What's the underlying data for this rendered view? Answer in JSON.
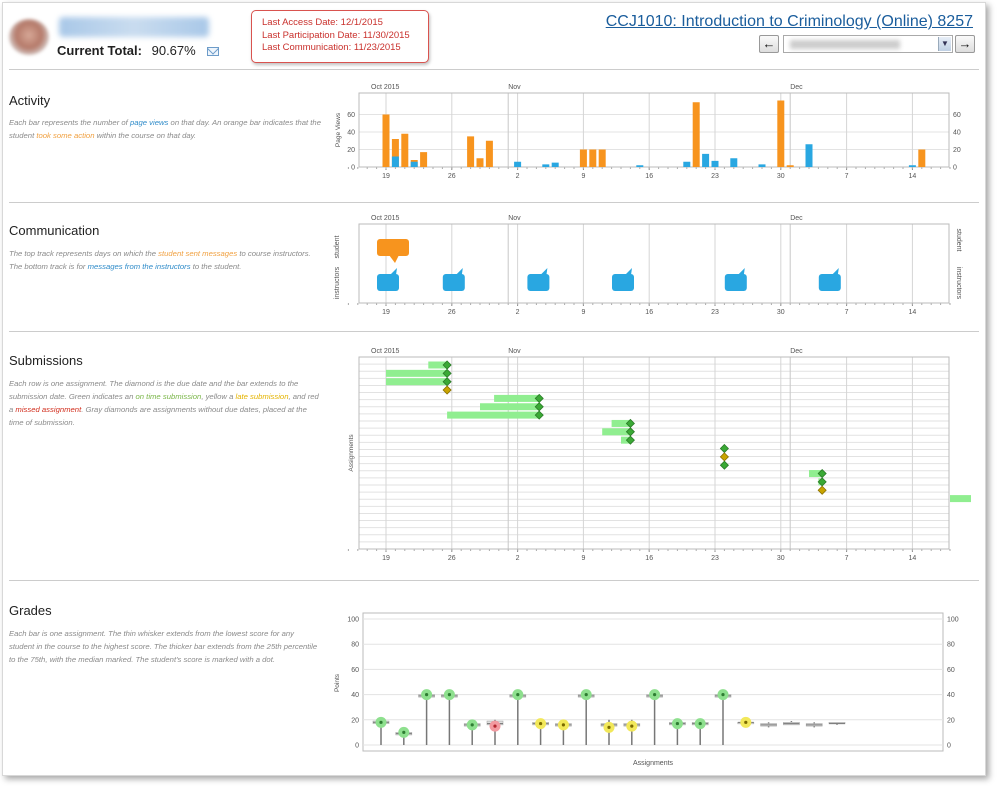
{
  "header": {
    "current_total_label": "Current Total:",
    "current_total_value": "90.67%",
    "last_access": "Last Access Date: 12/1/2015",
    "last_participation": "Last Participation Date: 11/30/2015",
    "last_communication": "Last Communication:  11/23/2015",
    "course_title": "CCJ1010: Introduction to Criminology (Online) 8257",
    "prev_label": "←",
    "next_label": "→"
  },
  "colors": {
    "orange": "#f7941e",
    "blue": "#29a7e1",
    "green": "#3aa935",
    "late_yellow": "#c9a400",
    "grid": "#d3d3d3",
    "submission_bar": "#90ee90"
  },
  "timeline": {
    "month_labels": [
      "Oct 2015",
      "Nov",
      "Dec"
    ],
    "day_ticks": [
      "19",
      "26",
      "2",
      "9",
      "16",
      "23",
      "30",
      "7",
      "14"
    ]
  },
  "activity": {
    "title": "Activity",
    "desc_1": "Each bar represents the number of ",
    "desc_link_1": "page views",
    "desc_2": " on that day. An orange bar indicates that the student ",
    "desc_link_2": "took some action",
    "desc_3": " within the course on that day.",
    "ylabel": "Page Views",
    "y_ticks": [
      "0",
      "20",
      "40",
      "60"
    ],
    "ymax": 80
  },
  "communication": {
    "title": "Communication",
    "desc_1": "The top track represents days on which the ",
    "desc_link_1": "student sent messages",
    "desc_2": " to course instructors. The bottom track is for ",
    "desc_link_2": "messages from the instructors",
    "desc_3": " to the student.",
    "track_student": "student",
    "track_instructors": "instructors"
  },
  "submissions": {
    "title": "Submissions",
    "desc_1": "Each row is one assignment. The diamond is the due date and the bar extends to the submission date. Green indicates an ",
    "desc_link_1": "on time submission",
    "desc_2": ", yellow a ",
    "desc_link_2": "late submission",
    "desc_3": ", and red a ",
    "desc_link_3": "missed assignment",
    "desc_4": ". Gray diamonds are assignments without due dates, placed at the time of submission.",
    "ylabel": "Assignments"
  },
  "grades": {
    "title": "Grades",
    "desc": "Each bar is one assignment. The thin whisker extends from the lowest score for any student in the course to the highest score. The thicker bar extends from the 25th percentile to the 75th, with the median marked. The student's score is marked with a dot.",
    "ylabel": "Points",
    "xlabel": "Assignments",
    "y_ticks": [
      "0",
      "20",
      "40",
      "60",
      "80",
      "100"
    ],
    "ymax": 100
  },
  "chart_data": [
    {
      "type": "bar",
      "title": "Activity",
      "ylabel": "Page Views",
      "ylim": [
        0,
        80
      ],
      "x_unit": "days since Oct 18 2015",
      "series": [
        {
          "name": "action",
          "color": "orange",
          "points": [
            [
              1,
              60
            ],
            [
              2,
              32
            ],
            [
              3,
              38
            ],
            [
              4,
              8
            ],
            [
              5,
              17
            ],
            [
              10,
              35
            ],
            [
              11,
              10
            ],
            [
              12,
              30
            ],
            [
              22,
              20
            ],
            [
              23,
              20
            ],
            [
              24,
              20
            ],
            [
              34,
              74
            ],
            [
              43,
              76
            ],
            [
              44,
              2
            ],
            [
              58,
              20
            ]
          ]
        },
        {
          "name": "views",
          "color": "blue",
          "points": [
            [
              2,
              12
            ],
            [
              4,
              6
            ],
            [
              15,
              6
            ],
            [
              18,
              3
            ],
            [
              19,
              5
            ],
            [
              28,
              2
            ],
            [
              33,
              6
            ],
            [
              35,
              15
            ],
            [
              36,
              7
            ],
            [
              38,
              10
            ],
            [
              41,
              3
            ],
            [
              46,
              26
            ],
            [
              57,
              2
            ]
          ]
        }
      ]
    },
    {
      "type": "scatter",
      "title": "Communication",
      "student_days": [
        1
      ],
      "instructor_days": [
        1,
        8,
        17,
        26,
        38,
        48
      ]
    },
    {
      "type": "scatter",
      "title": "Submissions",
      "ylabel": "Assignments",
      "rows": [
        {
          "start": 5.5,
          "end": 7.5,
          "due": 7.5,
          "status": "on_time"
        },
        {
          "start": 1,
          "end": 7.5,
          "due": 7.5,
          "status": "on_time"
        },
        {
          "start": 1,
          "end": 7.5,
          "due": 7.5,
          "status": "on_time"
        },
        {
          "start": 7.5,
          "end": 7.5,
          "due": 7.5,
          "status": "late"
        },
        {
          "start": 12.5,
          "end": 17.3,
          "due": 17.3,
          "status": "on_time"
        },
        {
          "start": 11,
          "end": 17.3,
          "due": 17.3,
          "status": "on_time"
        },
        {
          "start": 7.5,
          "end": 17.3,
          "due": 17.3,
          "status": "on_time"
        },
        {
          "start": 25,
          "end": 27,
          "due": 27,
          "status": "on_time"
        },
        {
          "start": 24,
          "end": 27,
          "due": 27,
          "status": "on_time"
        },
        {
          "start": 26,
          "end": 27,
          "due": 27,
          "status": "on_time"
        },
        {
          "start": 37,
          "end": 37,
          "due": 37,
          "status": "on_time"
        },
        {
          "start": 37,
          "end": 37,
          "due": 37,
          "status": "late"
        },
        {
          "start": 37,
          "end": 37,
          "due": 37,
          "status": "on_time"
        },
        {
          "start": 46,
          "end": 47.4,
          "due": 47.4,
          "status": "on_time"
        },
        {
          "start": 47,
          "end": 47.4,
          "due": 47.4,
          "status": "on_time"
        },
        {
          "start": 47.4,
          "end": 47.4,
          "due": 47.4,
          "status": "late"
        },
        {
          "start": 61,
          "end": 66.7,
          "due": 66.7,
          "status": "on_time"
        },
        {
          "start": 66.7,
          "end": 66.7,
          "due": 66.7,
          "status": "none"
        },
        {
          "start": 66.7,
          "end": 66.7,
          "due": 66.7,
          "status": "none"
        },
        {
          "start": 66.7,
          "end": 66.7,
          "due": 66.7,
          "status": "none"
        },
        {
          "start": 66.7,
          "end": 66.7,
          "due": 66.7,
          "status": "none"
        },
        {
          "start": 76.5,
          "end": 76.5,
          "due": 76.5,
          "status": "none"
        },
        {
          "start": 76.5,
          "end": 76.5,
          "due": 76.5,
          "status": "none"
        }
      ]
    },
    {
      "type": "scatter",
      "title": "Grades",
      "ylabel": "Points",
      "xlabel": "Assignments",
      "ylim": [
        0,
        100
      ],
      "assignments": [
        {
          "max": 20,
          "min": 0,
          "q1": 17,
          "median": 18,
          "q3": 19,
          "score": 18,
          "status": "full"
        },
        {
          "max": 10,
          "min": 0,
          "q1": 8,
          "median": 9,
          "q3": 10,
          "score": 10,
          "status": "full"
        },
        {
          "max": 40,
          "min": 0,
          "q1": 38,
          "median": 39,
          "q3": 40,
          "score": 40,
          "status": "full"
        },
        {
          "max": 40,
          "min": 0,
          "q1": 38,
          "median": 39,
          "q3": 40,
          "score": 40,
          "status": "full"
        },
        {
          "max": 18,
          "min": 0,
          "q1": 15,
          "median": 16,
          "q3": 17,
          "score": 16,
          "status": "full"
        },
        {
          "max": 20,
          "min": 0,
          "q1": 16,
          "median": 17,
          "q3": 19,
          "score": 15,
          "status": "low"
        },
        {
          "max": 40,
          "min": 0,
          "q1": 38,
          "median": 39,
          "q3": 40,
          "score": 40,
          "status": "full"
        },
        {
          "max": 20,
          "min": 0,
          "q1": 16,
          "median": 17,
          "q3": 18,
          "score": 17,
          "status": "partial"
        },
        {
          "max": 20,
          "min": 0,
          "q1": 15,
          "median": 16,
          "q3": 17,
          "score": 16,
          "status": "partial"
        },
        {
          "max": 40,
          "min": 0,
          "q1": 38,
          "median": 39,
          "q3": 40,
          "score": 40,
          "status": "full"
        },
        {
          "max": 20,
          "min": 0,
          "q1": 15,
          "median": 16,
          "q3": 17,
          "score": 14,
          "status": "partial"
        },
        {
          "max": 20,
          "min": 0,
          "q1": 15,
          "median": 16,
          "q3": 17,
          "score": 15,
          "status": "partial"
        },
        {
          "max": 40,
          "min": 0,
          "q1": 38,
          "median": 39,
          "q3": 40,
          "score": 40,
          "status": "full"
        },
        {
          "max": 18,
          "min": 0,
          "q1": 16,
          "median": 17,
          "q3": 18,
          "score": 17,
          "status": "full"
        },
        {
          "max": 18,
          "min": 0,
          "q1": 16,
          "median": 17,
          "q3": 18,
          "score": 17,
          "status": "full"
        },
        {
          "max": 40,
          "min": 0,
          "q1": 38,
          "median": 39,
          "q3": 40,
          "score": 40,
          "status": "full"
        },
        {
          "max": 20,
          "min": 18,
          "q1": 18,
          "median": 18,
          "q3": 18,
          "score": 18,
          "status": "partial"
        },
        {
          "max": 18,
          "min": 14,
          "q1": 15,
          "median": 16,
          "q3": 17,
          "score": null,
          "status": "none"
        },
        {
          "max": 19,
          "min": 16,
          "q1": 16,
          "median": 17,
          "q3": 18,
          "score": null,
          "status": "none"
        },
        {
          "max": 18,
          "min": 14,
          "q1": 15,
          "median": 16,
          "q3": 17,
          "score": null,
          "status": "none"
        },
        {
          "max": 18,
          "min": 16,
          "q1": 17,
          "median": 17,
          "q3": 18,
          "score": null,
          "status": "none"
        },
        {
          "max": 100,
          "min": 100,
          "q1": 100,
          "median": 100,
          "q3": 100,
          "score": null,
          "status": "none"
        }
      ]
    }
  ]
}
